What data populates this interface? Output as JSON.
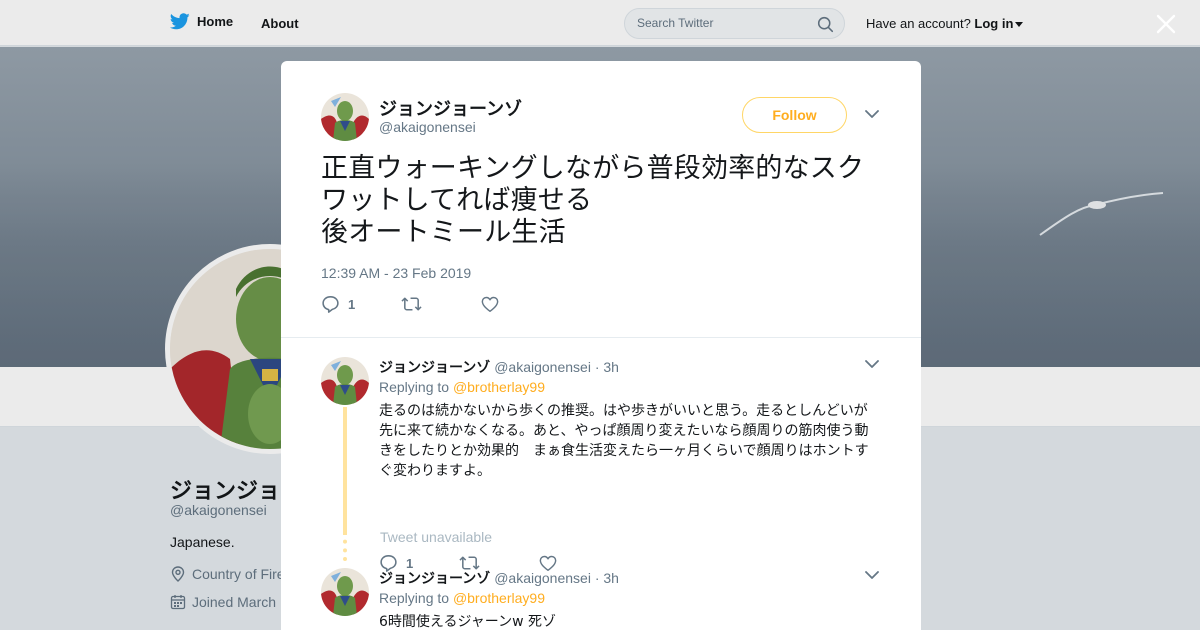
{
  "topbar": {
    "home_label": "Home",
    "about_label": "About",
    "search_placeholder": "Search Twitter",
    "account_prompt": "Have an account?",
    "login_label": "Log in"
  },
  "profile": {
    "name": "ジョンジョ",
    "handle": "@akaigonensei",
    "bio": "Japanese.",
    "location": "Country of Fire",
    "joined": "Joined March"
  },
  "tweet": {
    "author_name": "ジョンジョーンゾ",
    "author_handle": "@akaigonensei",
    "follow_label": "Follow",
    "text": "正直ウォーキングしながら普段効率的なスク\nワットしてれば痩せる\n後オートミール生活",
    "timestamp": "12:39 AM - 23 Feb 2019",
    "reply_count": "1",
    "retweet_count": "",
    "like_count": ""
  },
  "replies": [
    {
      "name": "ジョンジョーンゾ",
      "handle": "@akaigonensei",
      "dot": "·",
      "time": "3h",
      "replying_prefix": "Replying to",
      "replying_to": "@brotherlay99",
      "text": "走るのは続かないから歩くの推奨。はや歩きがいいと思う。走るとしんどいが先に来て続かなくなる。あと、やっぱ顔周り変えたいなら顔周りの筋肉使う動きをしたりとか効果的　まぁ食生活変えたら一ヶ月くらいで顔周りはホントすぐ変わりますよ。",
      "reply_count": "1"
    },
    {
      "name": "ジョンジョーンゾ",
      "handle": "@akaigonensei",
      "dot": "·",
      "time": "3h",
      "replying_prefix": "Replying to",
      "replying_to": "@brotherlay99",
      "text": "6時間使えるジャーンw 死ゾ",
      "reply_count": ""
    }
  ],
  "unavailable_text": "Tweet unavailable",
  "colors": {
    "accent": "#ffad1f",
    "follow_border": "#ffd666",
    "thread_line": "#ffe39e",
    "twitter_blue": "#1da1f2",
    "muted": "#657786"
  }
}
